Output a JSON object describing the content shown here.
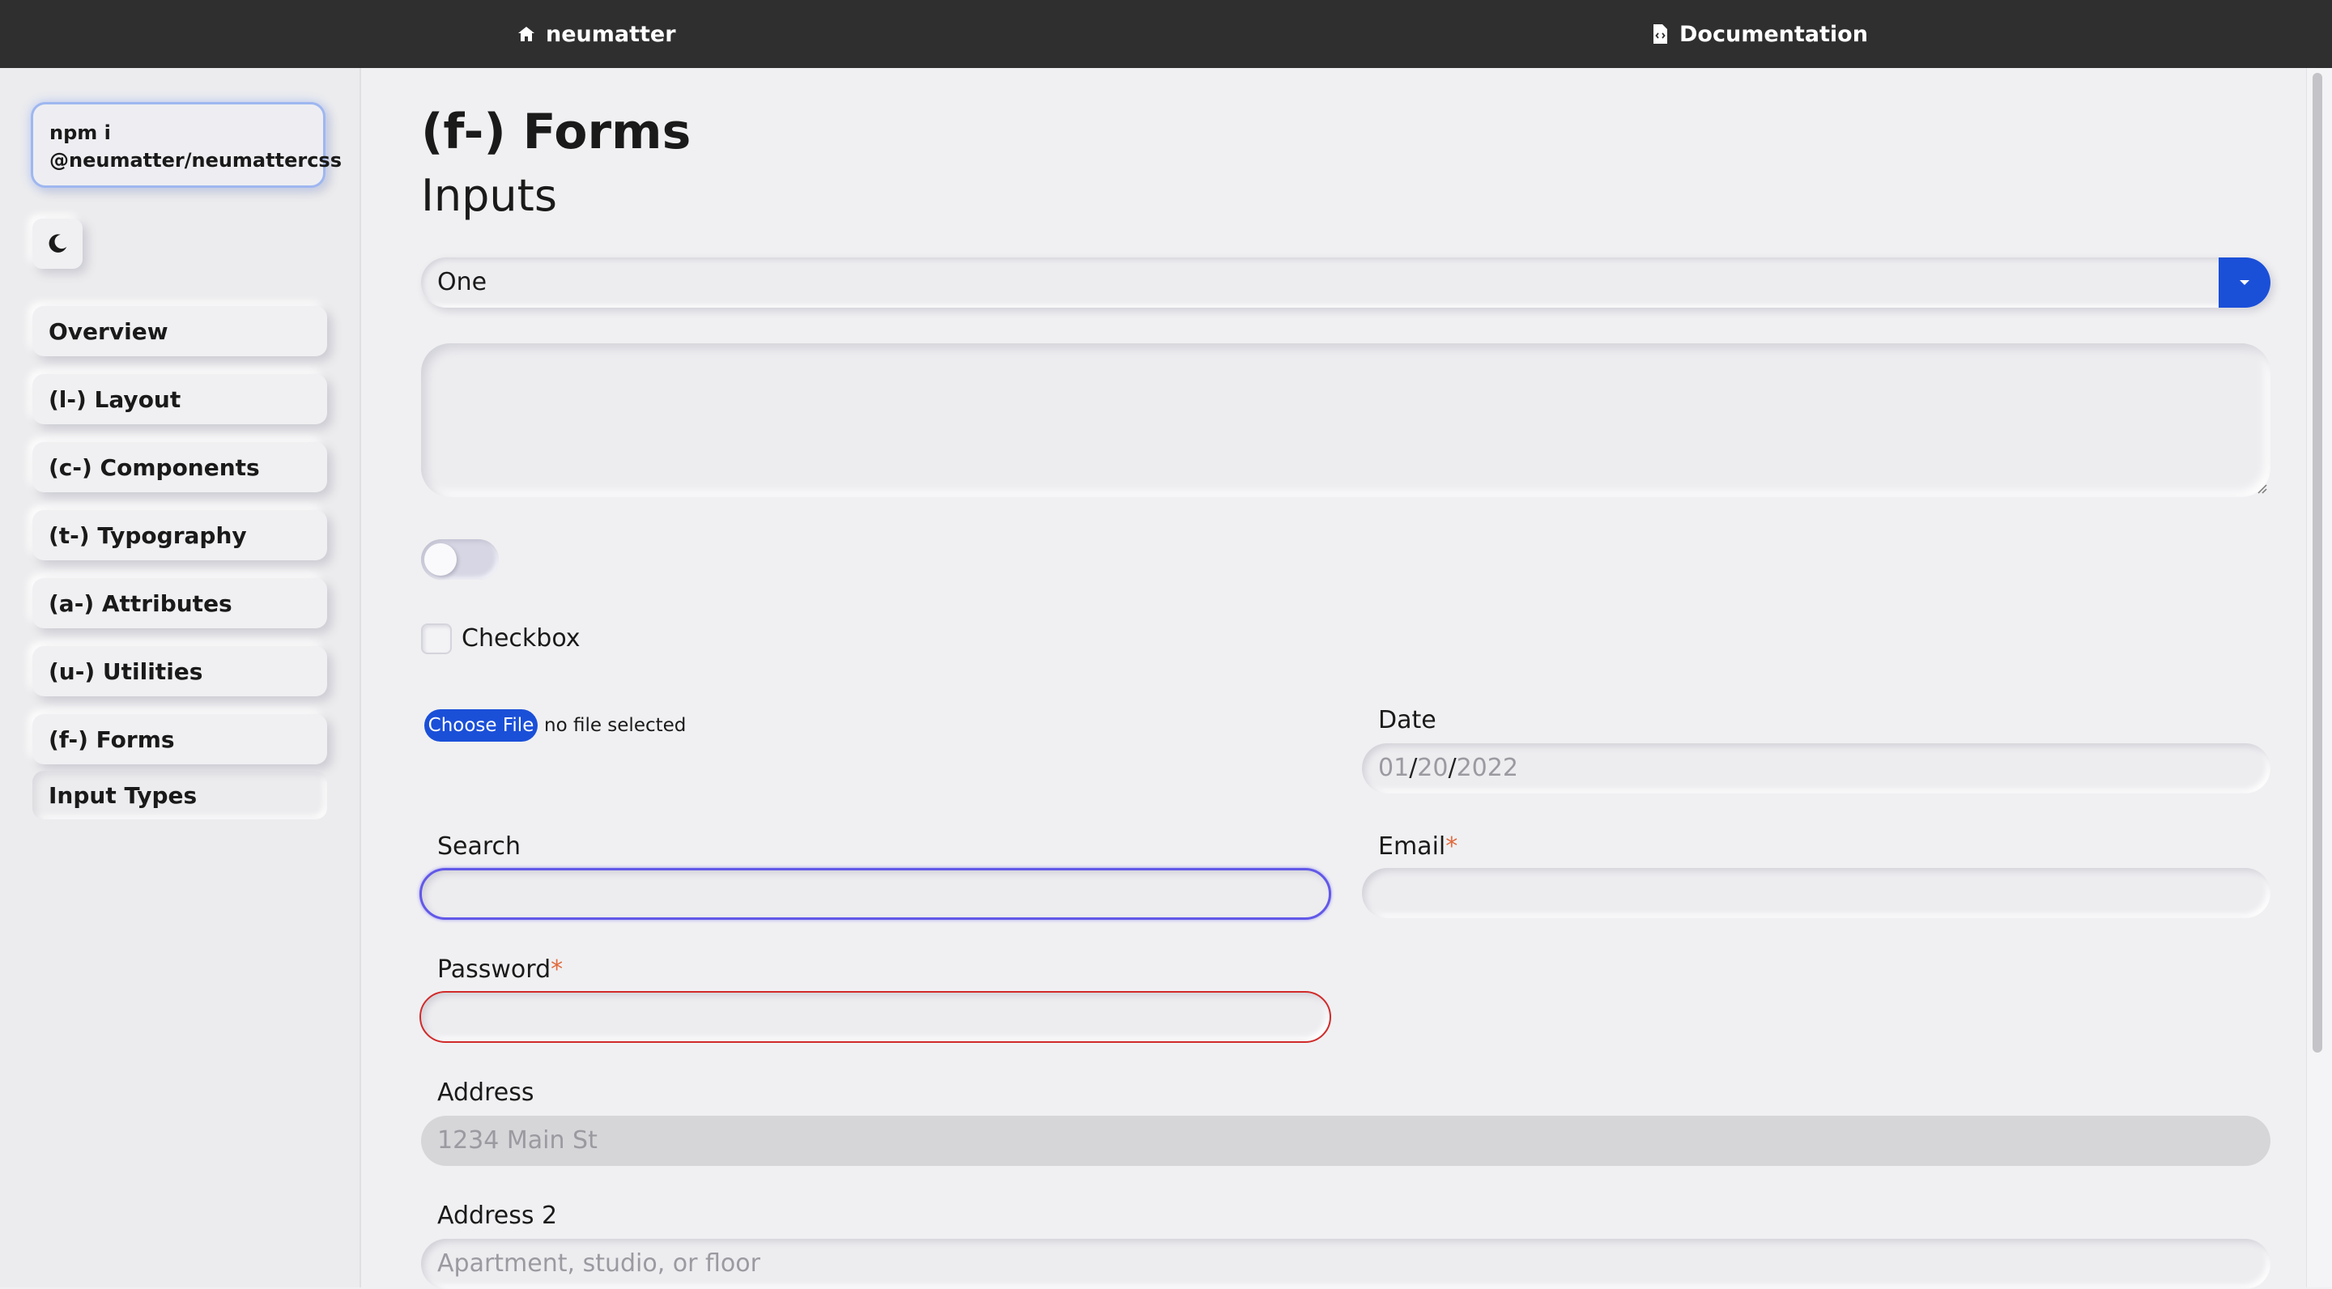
{
  "header": {
    "brand_icon": "home-icon",
    "brand_label": "neumatter",
    "docs_icon": "document-code-icon",
    "docs_label": "Documentation"
  },
  "sidebar": {
    "install_command": "npm i\n@neumatter/neumattercss",
    "theme_toggle_icon": "moon-icon",
    "items": [
      {
        "label": "Overview"
      },
      {
        "label": "(l-) Layout"
      },
      {
        "label": "(c-) Components"
      },
      {
        "label": "(t-) Typography"
      },
      {
        "label": "(a-) Attributes"
      },
      {
        "label": "(u-) Utilities"
      },
      {
        "label": "(f-) Forms"
      }
    ],
    "subitem": "Input Types"
  },
  "main": {
    "title": "(f-) Forms",
    "subtitle": "Inputs",
    "select": {
      "value": "One",
      "icon": "caret-down-icon",
      "accent": "#1a4fd8"
    },
    "textarea": {
      "value": ""
    },
    "toggle": {
      "checked": false
    },
    "checkbox": {
      "label": "Checkbox",
      "checked": false
    },
    "file": {
      "button_label": "Choose File",
      "status": "no file selected"
    },
    "date": {
      "label": "Date",
      "month": "01",
      "day": "20",
      "year": "2022",
      "sep": "/"
    },
    "search": {
      "label": "Search",
      "value": ""
    },
    "email": {
      "label": "Email",
      "required_mark": "*",
      "value": ""
    },
    "password": {
      "label": "Password",
      "required_mark": "*",
      "value": "",
      "error_color": "#d12a2a"
    },
    "address": {
      "label": "Address",
      "placeholder": "1234 Main St"
    },
    "address2": {
      "label": "Address 2",
      "placeholder": "Apartment, studio, or floor"
    }
  }
}
